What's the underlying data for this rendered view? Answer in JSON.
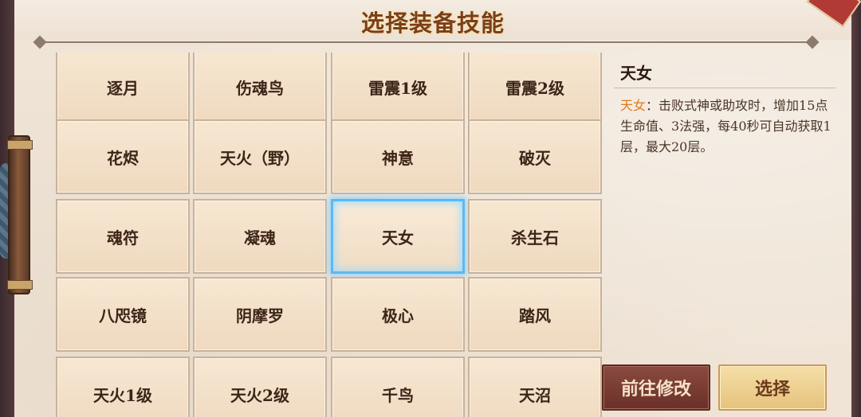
{
  "header": {
    "title": "选择装备技能"
  },
  "skills": [
    "逐月",
    "伤魂鸟",
    "雷震1级",
    "雷震2级",
    "花烬",
    "天火（野）",
    "神意",
    "破灭",
    "魂符",
    "凝魂",
    "天女",
    "杀生石",
    "八咫镜",
    "阴摩罗",
    "极心",
    "踏风",
    "天火1级",
    "天火2级",
    "千鸟",
    "天沼"
  ],
  "selected_skill": "天女",
  "detail": {
    "name": "天女",
    "desc_name": "天女",
    "desc_text": "：击败式神或助攻时，增加15点生命值、3法强，每40秒可自动获取1层，最大20层。"
  },
  "buttons": {
    "modify_label": "前往修改",
    "select_label": "选择"
  },
  "colors": {
    "panel_bg": "#efe4d6",
    "title": "#7a3f1a",
    "highlight": "#e07a1f",
    "selected_border": "#5fb8f2"
  }
}
